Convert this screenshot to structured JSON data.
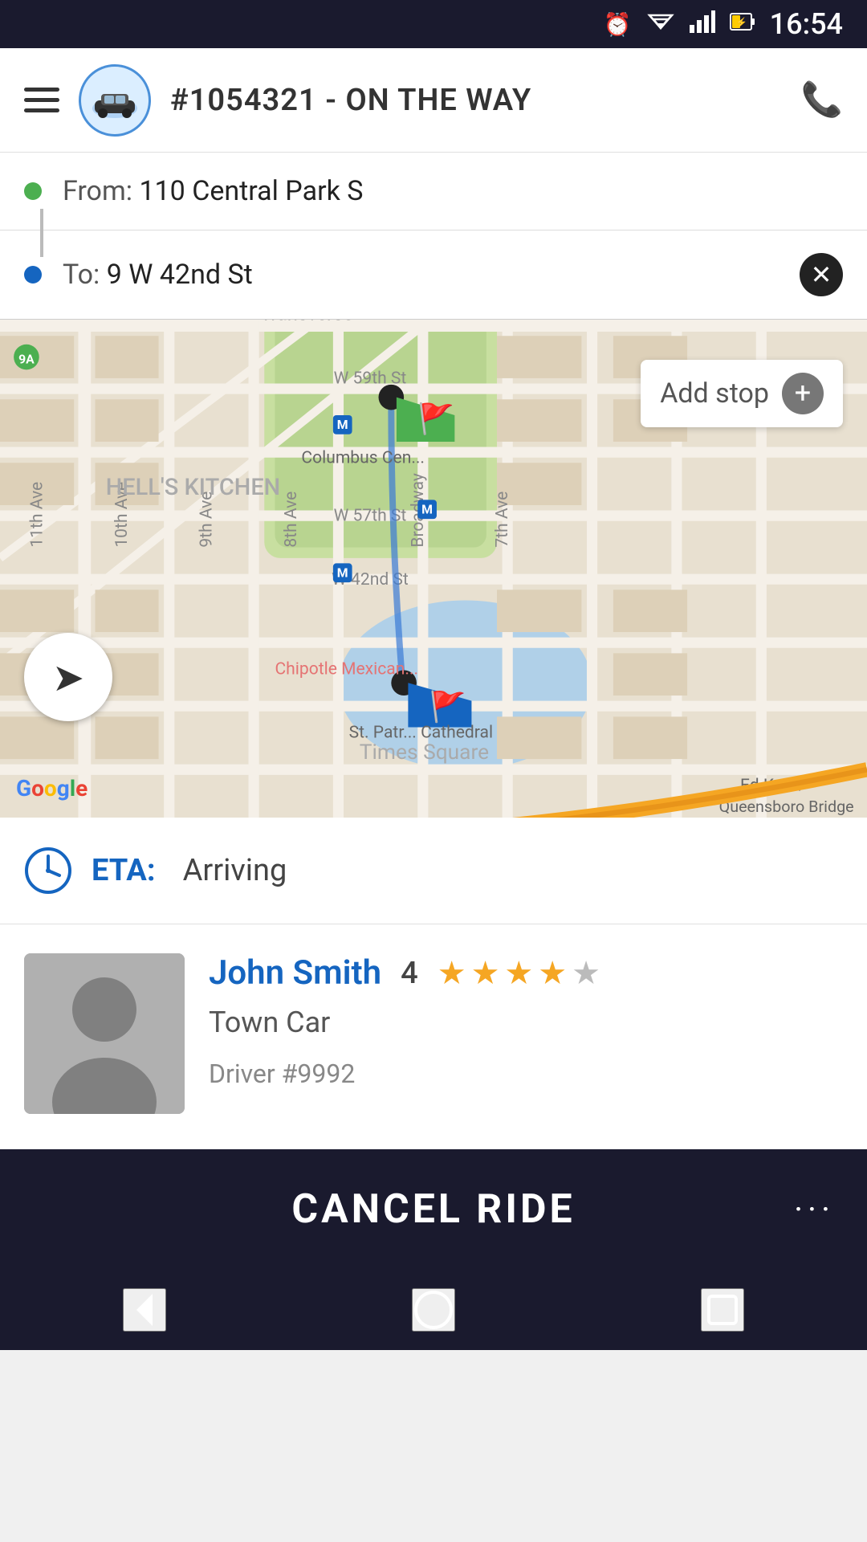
{
  "status_bar": {
    "time": "16:54",
    "icons": [
      "alarm-icon",
      "wifi-icon",
      "signal-icon",
      "battery-icon"
    ]
  },
  "header": {
    "menu_label": "menu",
    "ride_id": "#1054321",
    "status": "ON THE WAY",
    "title": "#1054321 - ON THE WAY",
    "phone_icon": "phone-icon"
  },
  "route": {
    "from_label": "From:",
    "from_address": "110 Central Park S",
    "to_label": "To:",
    "to_address": "9 W 42nd St",
    "add_stop_label": "Add stop"
  },
  "map": {
    "google_logo": "Google"
  },
  "eta": {
    "label": "ETA:",
    "value": "Arriving"
  },
  "driver": {
    "name": "John Smith",
    "rating_number": "4",
    "stars_filled": 4,
    "stars_total": 5,
    "car_type": "Town Car",
    "driver_number": "Driver #9992"
  },
  "cancel": {
    "label": "CANCEL RIDE",
    "more_dots": "···"
  },
  "bottom_nav": {
    "back_icon": "◁",
    "home_icon": "○",
    "recent_icon": "□"
  }
}
